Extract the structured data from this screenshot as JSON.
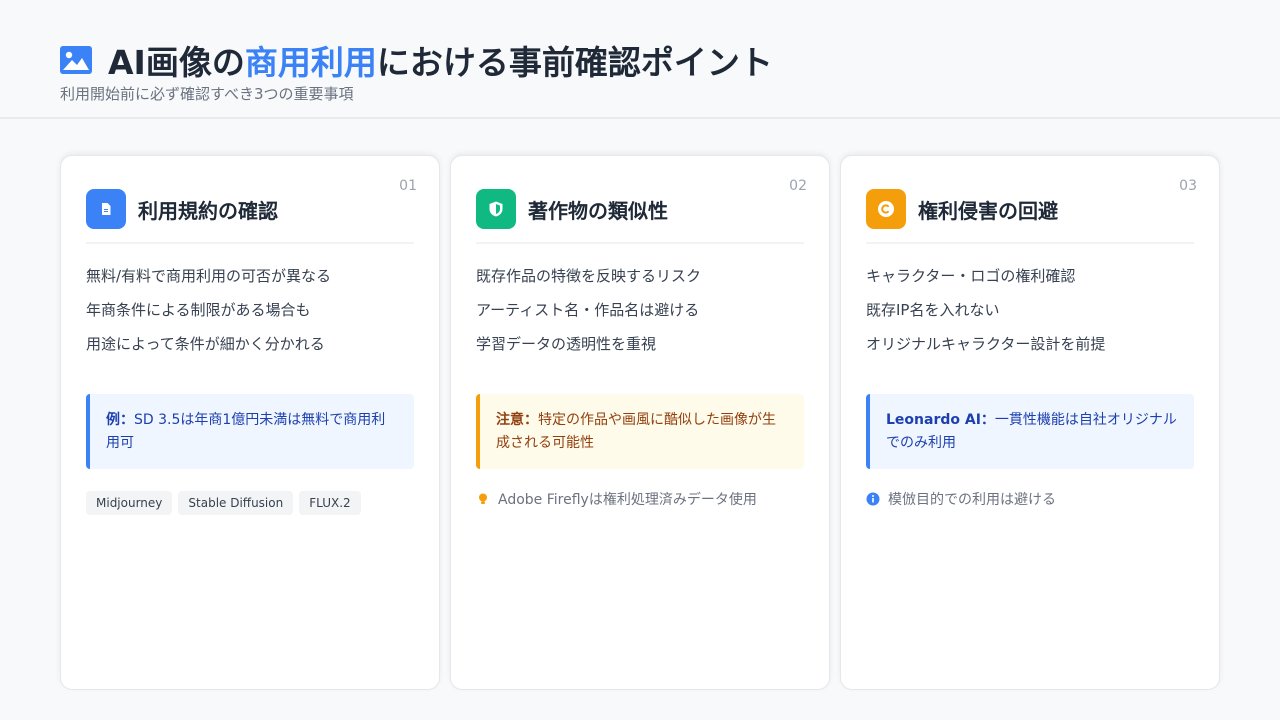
{
  "header": {
    "icon": "image-icon",
    "title_prefix": "AI画像の",
    "title_accent": "商用利用",
    "title_suffix": "における事前確認ポイント",
    "subtitle": "利用開始前に必ず確認すべき3つの重要事項",
    "accent_color": "#3b82f6"
  },
  "cards": [
    {
      "number": "01",
      "icon": "document-icon",
      "icon_color": "#3b82f6",
      "title": "利用規約の確認",
      "bullets": [
        "無料/有料で商用利用の可否が異なる",
        "年商条件による制限がある場合も",
        "用途によって条件が細かく分かれる"
      ],
      "callout_label": "例：",
      "callout_text": "SD 3.5は年商1億円未満は無料で商用利用可",
      "tags": [
        "Midjourney",
        "Stable Diffusion",
        "FLUX.2"
      ]
    },
    {
      "number": "02",
      "icon": "shield-icon",
      "icon_color": "#10b981",
      "title": "著作物の類似性",
      "bullets": [
        "既存作品の特徴を反映するリスク",
        "アーティスト名・作品名は避ける",
        "学習データの透明性を重視"
      ],
      "callout_label": "注意：",
      "callout_text": "特定の作品や画風に酷似した画像が生成される可能性",
      "note_icon": "lightbulb-icon",
      "note": "Adobe Fireflyは権利処理済みデータ使用"
    },
    {
      "number": "03",
      "icon": "copyright-icon",
      "icon_color": "#f59e0b",
      "title": "権利侵害の回避",
      "bullets": [
        "キャラクター・ロゴの権利確認",
        "既存IP名を入れない",
        "オリジナルキャラクター設計を前提"
      ],
      "callout_label": "Leonardo AI：",
      "callout_text": "一貫性機能は自社オリジナルでのみ利用",
      "note_icon": "info-icon",
      "note": "模倣目的での利用は避ける"
    }
  ]
}
